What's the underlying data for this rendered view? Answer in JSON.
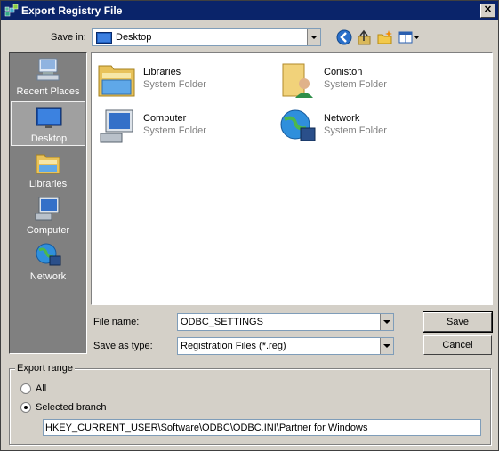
{
  "window": {
    "title": "Export Registry File",
    "close_label": "✕"
  },
  "toolbar": {
    "save_in_label": "Save in:",
    "location": "Desktop"
  },
  "places": [
    {
      "label": "Recent Places",
      "icon": "recent-places-icon"
    },
    {
      "label": "Desktop",
      "icon": "desktop-icon",
      "selected": true
    },
    {
      "label": "Libraries",
      "icon": "libraries-icon"
    },
    {
      "label": "Computer",
      "icon": "computer-icon"
    },
    {
      "label": "Network",
      "icon": "network-icon"
    }
  ],
  "files": [
    {
      "name": "Libraries",
      "type": "System Folder",
      "icon": "libraries-folder-icon"
    },
    {
      "name": "Coniston",
      "type": "System Folder",
      "icon": "user-folder-icon"
    },
    {
      "name": "Computer",
      "type": "System Folder",
      "icon": "computer-icon"
    },
    {
      "name": "Network",
      "type": "System Folder",
      "icon": "network-icon"
    }
  ],
  "form": {
    "file_name_label": "File name:",
    "file_name_value": "ODBC_SETTINGS",
    "save_type_label": "Save as type:",
    "save_type_value": "Registration Files (*.reg)"
  },
  "buttons": {
    "save": "Save",
    "cancel": "Cancel"
  },
  "export_range": {
    "title": "Export range",
    "all_label": "All",
    "selected_label": "Selected branch",
    "branch_value": "HKEY_CURRENT_USER\\Software\\ODBC\\ODBC.INI\\Partner for Windows"
  }
}
